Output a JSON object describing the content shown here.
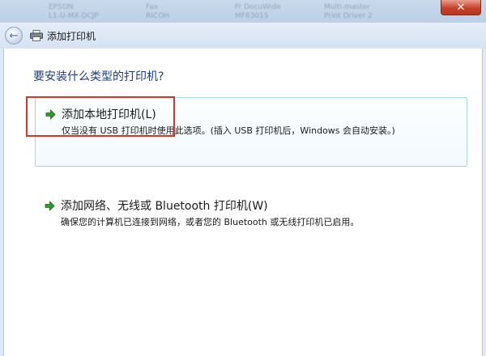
{
  "background_window": {
    "cells": [
      "EPSON",
      "Fax",
      "Fr DocuWide",
      "Multi-master",
      "L1-U-MX-DCJP",
      "RICOH",
      "MF8301S",
      "Print Driver 2"
    ]
  },
  "window": {
    "close_label": "✕"
  },
  "nav": {
    "title": "添加打印机"
  },
  "main": {
    "question": "要安装什么类型的打印机?",
    "option_local": {
      "title": "添加本地打印机(L)",
      "description": "仅当没有 USB 打印机时使用此选项。(插入 USB 打印机后，Windows 会自动安装。)"
    },
    "option_network": {
      "title": "添加网络、无线或 Bluetooth 打印机(W)",
      "description": "确保您的计算机已连接到网络，或者您的 Bluetooth 或无线打印机已启用。"
    }
  },
  "colors": {
    "accent_arrow": "#2d9a2a",
    "highlight_box": "#e0302a",
    "question_text": "#1f3d7a"
  }
}
